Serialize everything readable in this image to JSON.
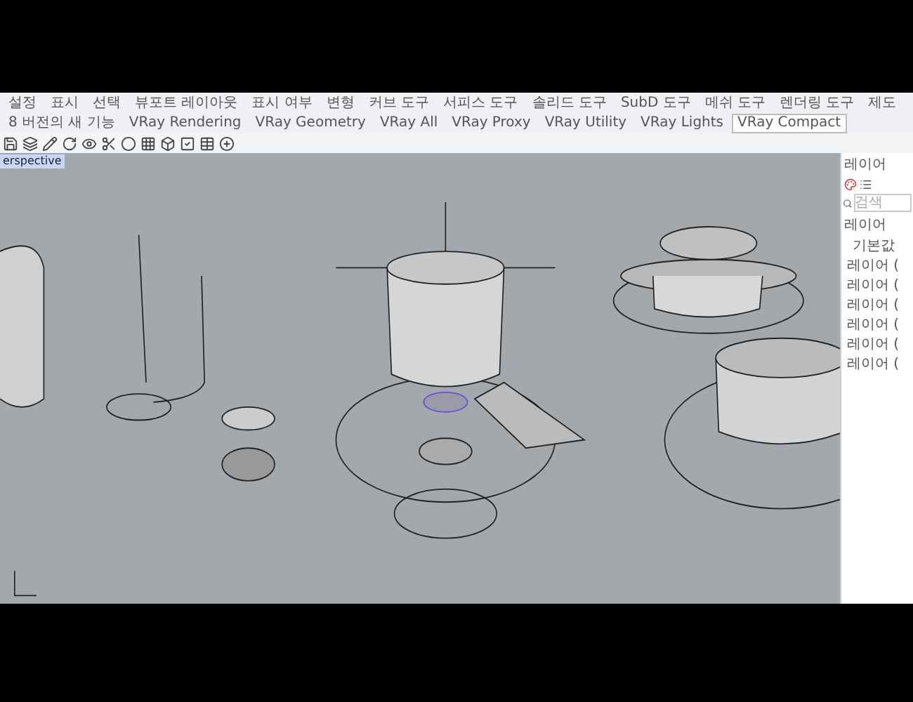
{
  "tabs": [
    {
      "label": "설정",
      "selected": false
    },
    {
      "label": "표시",
      "selected": false
    },
    {
      "label": "선택",
      "selected": false
    },
    {
      "label": "뷰포트 레이아웃",
      "selected": false
    },
    {
      "label": "표시 여부",
      "selected": false
    },
    {
      "label": "변형",
      "selected": false
    },
    {
      "label": "커브 도구",
      "selected": false
    },
    {
      "label": "서피스 도구",
      "selected": false
    },
    {
      "label": "솔리드 도구",
      "selected": false
    },
    {
      "label": "SubD 도구",
      "selected": false
    },
    {
      "label": "메쉬 도구",
      "selected": false
    },
    {
      "label": "렌더링 도구",
      "selected": false
    },
    {
      "label": "제도",
      "selected": false
    },
    {
      "label": "8 버전의 새 기능",
      "selected": false
    },
    {
      "label": "VRay Rendering",
      "selected": false
    },
    {
      "label": "VRay Geometry",
      "selected": false
    },
    {
      "label": "VRay All",
      "selected": false
    },
    {
      "label": "VRay Proxy",
      "selected": false
    },
    {
      "label": "VRay Utility",
      "selected": false
    },
    {
      "label": "VRay Lights",
      "selected": false
    },
    {
      "label": "VRay Compact",
      "selected": true
    }
  ],
  "viewport": {
    "label": "erspective"
  },
  "layers_panel": {
    "title": "레이어",
    "search": {
      "placeholder": "검색"
    },
    "header": "레이어",
    "items": [
      "기본값",
      "레이어 (",
      "레이어 (",
      "레이어 (",
      "레이어 (",
      "레이어 (",
      "레이어 ("
    ]
  }
}
